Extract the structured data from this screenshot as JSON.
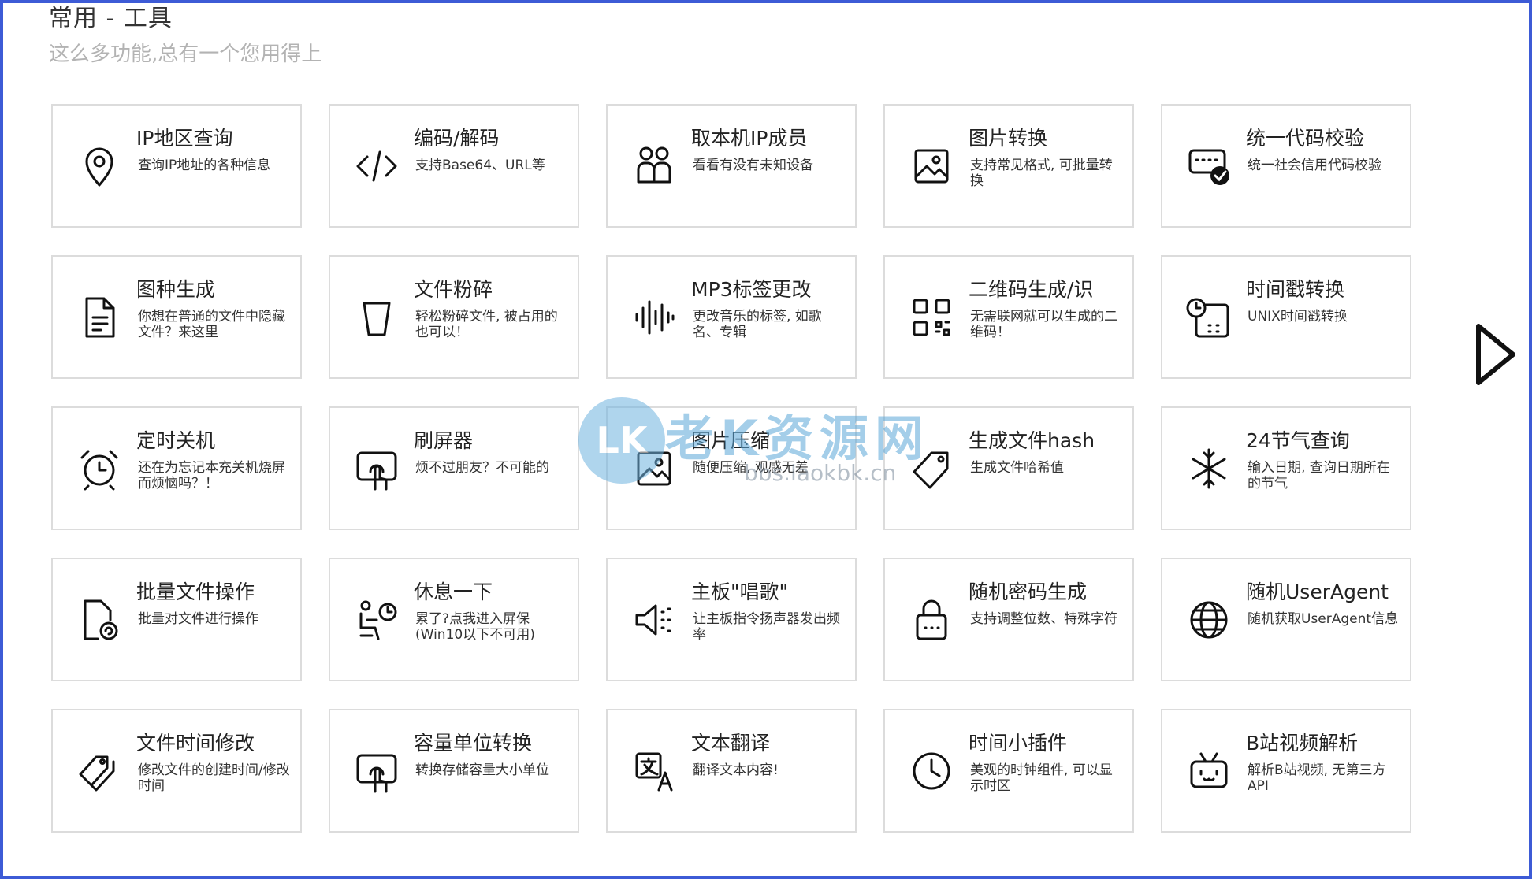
{
  "header": {
    "title": "常用 - 工具",
    "subtitle": "这么多功能,总有一个您用得上"
  },
  "tools": [
    {
      "title": "IP地区查询",
      "desc": "查询IP地址的各种信息",
      "icon": "location-pin-icon"
    },
    {
      "title": "编码/解码",
      "desc": "支持Base64、URL等",
      "icon": "code-icon"
    },
    {
      "title": "取本机IP成员",
      "desc": "看看有没有未知设备",
      "icon": "users-icon"
    },
    {
      "title": "图片转换",
      "desc": "支持常见格式, 可批量转换",
      "icon": "image-icon"
    },
    {
      "title": "统一代码校验",
      "desc": "统一社会信用代码校验",
      "icon": "verify-card-icon"
    },
    {
      "title": "图种生成",
      "desc": "你想在普通的文件中隐藏文件？来这里",
      "icon": "document-icon"
    },
    {
      "title": "文件粉碎",
      "desc": "轻松粉碎文件, 被占用的也可以！",
      "icon": "trash-cup-icon"
    },
    {
      "title": "MP3标签更改",
      "desc": "更改音乐的标签, 如歌名、专辑",
      "icon": "audio-wave-icon"
    },
    {
      "title": "二维码生成/识",
      "desc": "无需联网就可以生成的二维码！",
      "icon": "qr-code-icon"
    },
    {
      "title": "时间戳转换",
      "desc": "UNIX时间戳转换",
      "icon": "calendar-clock-icon"
    },
    {
      "title": "定时关机",
      "desc": "还在为忘记本充关机烧屏而烦恼吗？！",
      "icon": "alarm-clock-icon"
    },
    {
      "title": "刷屏器",
      "desc": "烦不过朋友？不可能的",
      "icon": "touch-screen-icon"
    },
    {
      "title": "图片压缩",
      "desc": "随便压缩, 观感无差",
      "icon": "image-compress-icon"
    },
    {
      "title": "生成文件hash",
      "desc": "生成文件哈希值",
      "icon": "tag-icon"
    },
    {
      "title": "24节气查询",
      "desc": "输入日期, 查询日期所在的节气",
      "icon": "snowflake-icon"
    },
    {
      "title": "批量文件操作",
      "desc": "批量对文件进行操作",
      "icon": "file-sync-icon"
    },
    {
      "title": "休息一下",
      "desc": "累了?点我进入屏保(Win10以下不可用)",
      "icon": "rest-person-icon"
    },
    {
      "title": "主板\"唱歌\"",
      "desc": "让主板指令扬声器发出频率",
      "icon": "speaker-icon"
    },
    {
      "title": "随机密码生成",
      "desc": "支持调整位数、特殊字符",
      "icon": "lock-icon"
    },
    {
      "title": "随机UserAgent",
      "desc": "随机获取UserAgent信息",
      "icon": "globe-icon"
    },
    {
      "title": "文件时间修改",
      "desc": "修改文件的创建时间/修改时间",
      "icon": "tags-icon"
    },
    {
      "title": "容量单位转换",
      "desc": "转换存储容量大小单位",
      "icon": "touch-screen-icon"
    },
    {
      "title": "文本翻译",
      "desc": "翻译文本内容!",
      "icon": "translate-icon"
    },
    {
      "title": "时间小插件",
      "desc": "美观的时钟组件, 可以显示时区",
      "icon": "clock-icon"
    },
    {
      "title": "B站视频解析",
      "desc": "解析B站视频, 无第三方API",
      "icon": "bilibili-tv-icon"
    }
  ],
  "watermark": {
    "logo": "LK",
    "main": "老K资源网",
    "sub": "bbs.laokbk.cn"
  }
}
